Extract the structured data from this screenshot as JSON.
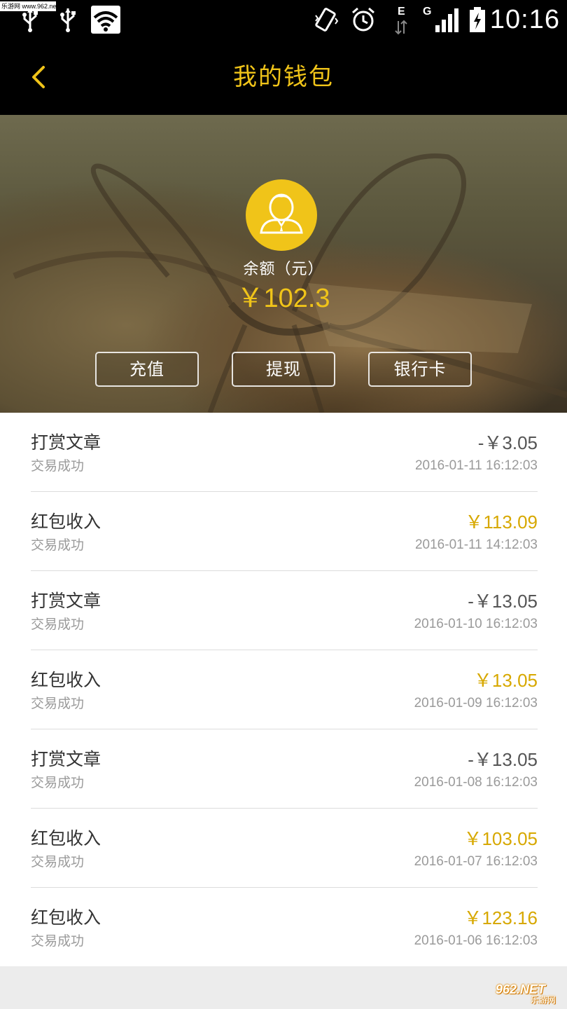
{
  "status_bar": {
    "watermark": "乐游网 www.962.net",
    "network_letter_top": "E",
    "network_letter_g": "G",
    "time": "10:16",
    "icons": [
      "usb-icon",
      "usb-icon",
      "wifi-icon",
      "vibrate-icon",
      "alarm-icon",
      "data-transfer-icon",
      "signal-icon",
      "battery-charging-icon"
    ]
  },
  "header": {
    "title": "我的钱包",
    "back_icon": "chevron-left-icon",
    "accent_color": "#f0c419"
  },
  "hero": {
    "avatar_icon": "user-avatar-icon",
    "balance_label": "余额（元）",
    "balance_value": "￥102.3",
    "buttons": [
      {
        "label": "充值"
      },
      {
        "label": "提现"
      },
      {
        "label": "银行卡"
      }
    ]
  },
  "transactions": [
    {
      "title": "打赏文章",
      "status": "交易成功",
      "amount": "-￥3.05",
      "date": "2016-01-11 16:12:03",
      "type": "expense"
    },
    {
      "title": "红包收入",
      "status": "交易成功",
      "amount": "￥113.09",
      "date": "2016-01-11 14:12:03",
      "type": "income"
    },
    {
      "title": "打赏文章",
      "status": "交易成功",
      "amount": "-￥13.05",
      "date": "2016-01-10 16:12:03",
      "type": "expense"
    },
    {
      "title": "红包收入",
      "status": "交易成功",
      "amount": "￥13.05",
      "date": "2016-01-09 16:12:03",
      "type": "income"
    },
    {
      "title": "打赏文章",
      "status": "交易成功",
      "amount": "-￥13.05",
      "date": "2016-01-08 16:12:03",
      "type": "expense"
    },
    {
      "title": "红包收入",
      "status": "交易成功",
      "amount": "￥103.05",
      "date": "2016-01-07 16:12:03",
      "type": "income"
    },
    {
      "title": "红包收入",
      "status": "交易成功",
      "amount": "￥123.16",
      "date": "2016-01-06 16:12:03",
      "type": "income"
    }
  ],
  "colors": {
    "income": "#d7a800",
    "expense": "#555555"
  },
  "footer_watermark": {
    "brand": "962.NET",
    "sub": "乐游网"
  }
}
